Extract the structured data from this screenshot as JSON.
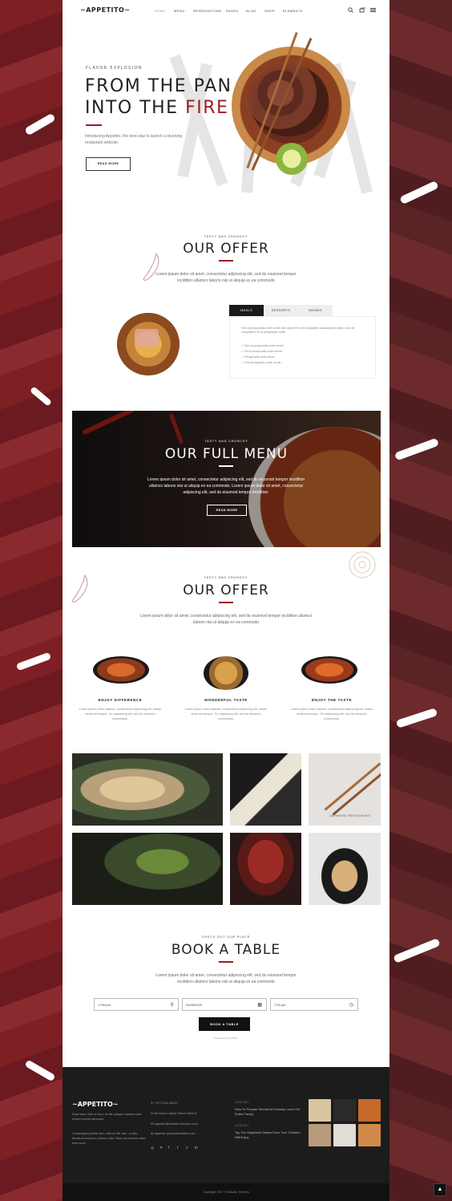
{
  "nav": {
    "logo": "~APPETITO~",
    "items": [
      "HOME",
      "MENU",
      "RESERVATIONS",
      "PAGES",
      "BLOG",
      "SHOP",
      "ELEMENTS"
    ],
    "active": "HOME"
  },
  "hero": {
    "kicker": "FLAVOR EXPLOSION",
    "title_line1": "FROM THE PAN",
    "title_line2a": "INTO THE ",
    "title_line2b": "FIRE",
    "text": "Introducing Appetito, the best way to launch a stunning restaurant website.",
    "button": "READ MORE"
  },
  "offer1": {
    "kicker": "TASTY AND CRUNCHY",
    "title": "OUR OFFER",
    "text": "Lorem ipsum dolor sit amet, consectetur adipiscing elit, sed do eiusmod tempor incidition ullamco laboris nisi ut aliquip ex ea commodo",
    "tabs": [
      "MEALS",
      "DESSERTS",
      "DRINKS"
    ],
    "panel_text": "Sed ut perspiciatis unde omnis iste natus error sit voluptatem accusantium natus error sit voluptatem. Et ut perspiciatis unde.",
    "list": [
      "Sed ut perspiciatis unde omnis",
      "Ed ut perspiciatis unde omnis",
      "Perspiciatis unde omnis",
      "Ordi perspiciatis unde omnis"
    ]
  },
  "fullmenu": {
    "kicker": "TASTY AND CRUNCHY",
    "title": "OUR FULL MENU",
    "text": "Lorem ipsum dolor sit amet, consectetur adipiscing elit, sed do eiusmod tempor incidition ullamco laboris nisi ut aliquip ex ea commodo. Lorem ipsum dolor sit amet, consectetur adipiscing elit, sed do eiusmod tempor incidition.",
    "button": "READ MORE"
  },
  "offer2": {
    "kicker": "TASTY AND CRUNCHY",
    "title": "OUR OFFER",
    "text": "Lorem ipsum dolor sit amet, consectetur adipiscing elit, sed do eiusmod tempor incidition ullamco laboris nisi ut aliquip ex ea commodo",
    "features": [
      {
        "title": "ENJOY DIFFERENCE",
        "text": "Lorem ipsum dolor sitamet, consectetur adipiscing elit, seddo eiusmod tempor. Tor adipiscing elit, sed do eiusmod consectetur."
      },
      {
        "title": "WONDERFUL TASTE",
        "text": "Lorem ipsum dolor sitamet, consectetur adipiscing elit, seddo eiusmod tempor. Tor adipiscing elit, sed do eiusmod consectetur."
      },
      {
        "title": "ENJOY THE TASTE",
        "text": "Lorem ipsum dolor sitamet, consectetur adipiscing elit, seddo eiusmod tempor. Tor adipiscing elit, sed do eiusmod consectetur."
      }
    ]
  },
  "gallery": {
    "sign_text": "JAPANESE RESTAURANT"
  },
  "booking": {
    "kicker": "CHECK OUT OUR PLACE",
    "title": "BOOK A TABLE",
    "text": "Lorem ipsum dolor sit amet, consectetur adipiscing elit, sed do eiusmod tempor incidition ullamco laboris nisi ut aliquip ex ea commodo",
    "persons": "1 Person",
    "date": "02/09/2020",
    "time": "7:00 pm",
    "button": "BOOK A TABLE",
    "powered": "Powered by OpenTable"
  },
  "footer": {
    "logo": "~APPETITO~",
    "about1": "Ente facer falli no duo, at elit oblique fuisset nam, movet putent albucius.",
    "about2": "Consequat ipsutis sem nibh id elit. she. a odio. tincidunt auctor a ornare odio. Sed non mauris vitae erat cons.",
    "phone": "+477-514-44027",
    "address": "Ilia Main Collins Street West 8",
    "email": "appetito@mikado-themes.com",
    "web": "appetito.qodeinteractive.com",
    "posts": [
      {
        "date": "02.08.2017",
        "title": "How To Prepare Wonderful Sunday Lunch For Entire Family"
      },
      {
        "date": "02.08.2017",
        "title": "Top Ten Vegetable Dishes Even Your Children Will Enjoy"
      }
    ],
    "copyright": "Copyright 2017 © Mikado Themes"
  },
  "colors": {
    "accent": "#9b1c24",
    "gold": "#b79566",
    "dark": "#1c1c1c"
  }
}
